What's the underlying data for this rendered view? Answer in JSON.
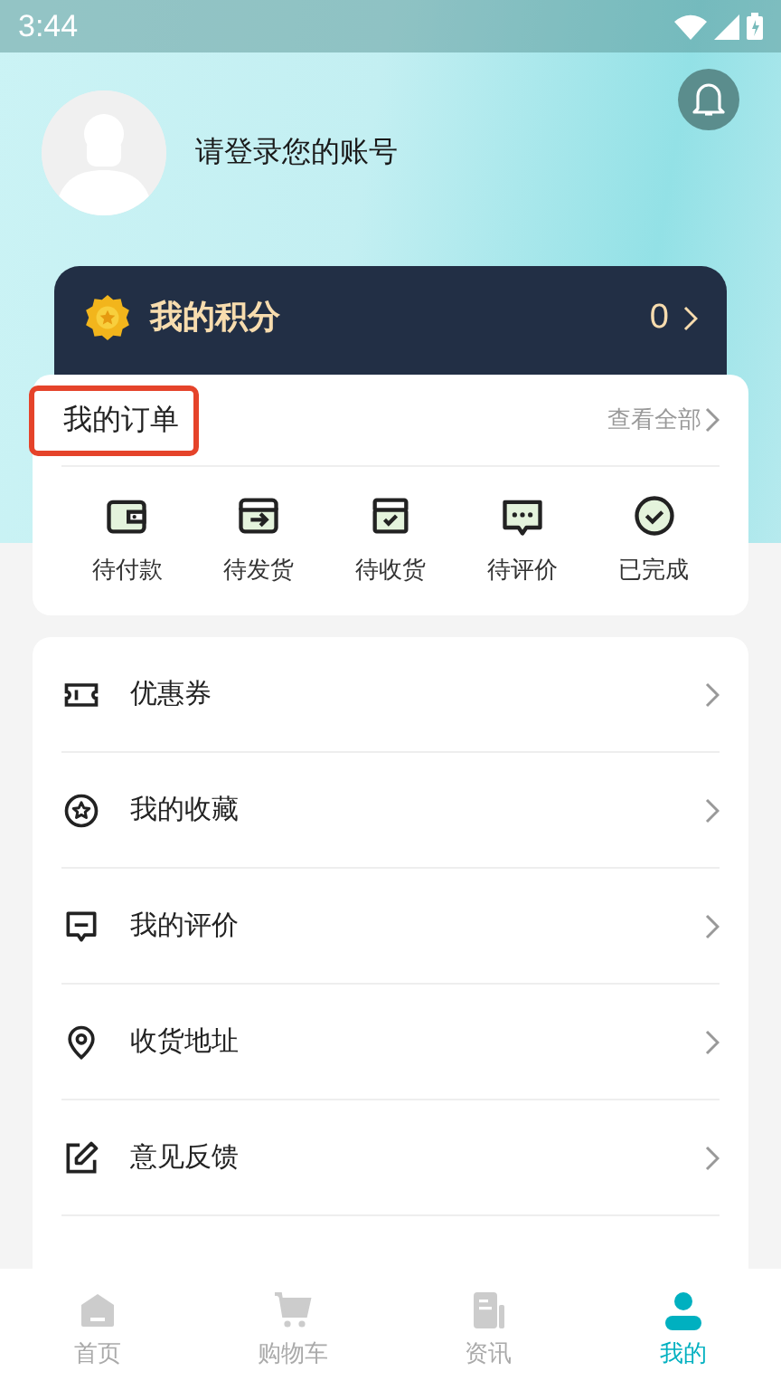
{
  "status_bar": {
    "time": "3:44"
  },
  "profile": {
    "login_prompt": "请登录您的账号"
  },
  "points": {
    "title": "我的积分",
    "value": "0"
  },
  "orders": {
    "title": "我的订单",
    "title_highlighted": true,
    "view_all": "查看全部",
    "items": [
      {
        "kind": "wallet",
        "label": "待付款"
      },
      {
        "kind": "ship",
        "label": "待发货"
      },
      {
        "kind": "box",
        "label": "待收货"
      },
      {
        "kind": "chat",
        "label": "待评价"
      },
      {
        "kind": "done",
        "label": "已完成"
      }
    ]
  },
  "menu": [
    {
      "kind": "ticket",
      "label": "优惠券"
    },
    {
      "kind": "star",
      "label": "我的收藏"
    },
    {
      "kind": "comment",
      "label": "我的评价"
    },
    {
      "kind": "pin",
      "label": "收货地址"
    },
    {
      "kind": "edit",
      "label": "意见反馈"
    }
  ],
  "tab_bar": [
    {
      "kind": "home",
      "label": "首页",
      "selected": false
    },
    {
      "kind": "cart",
      "label": "购物车",
      "selected": false
    },
    {
      "kind": "news",
      "label": "资讯",
      "selected": false
    },
    {
      "kind": "me",
      "label": "我的",
      "selected": true
    }
  ]
}
